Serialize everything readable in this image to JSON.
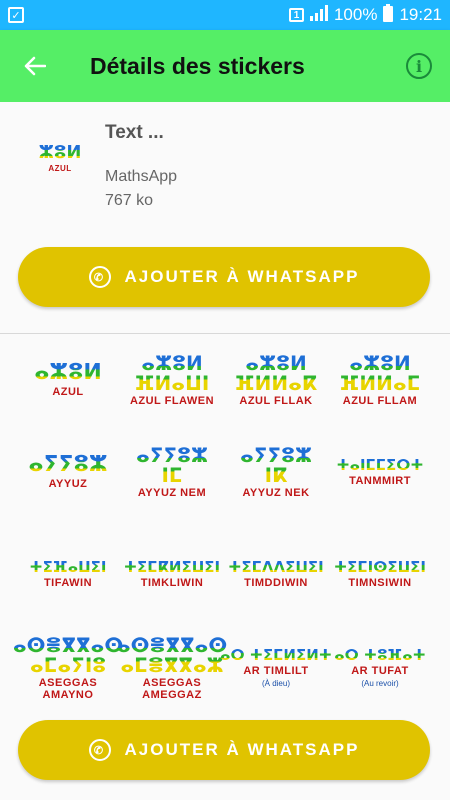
{
  "status_bar": {
    "sim": "1",
    "battery": "100%",
    "time": "19:21"
  },
  "app_bar": {
    "title": "Détails des stickers"
  },
  "pack": {
    "tray_glyphs": "ⵣⵓⵍ",
    "tray_label": "AZUL",
    "name": "Text ...",
    "publisher": "MathsApp",
    "size": "767 ko"
  },
  "buttons": {
    "add_label": "AJOUTER À WHATSAPP"
  },
  "stickers": [
    {
      "glyphs": "ⴰⵣⵓⵍ",
      "label": "AZUL",
      "sub": ""
    },
    {
      "glyphs": "ⴰⵣⵓⵍ\nⴼⵍⴰⵡⵏ",
      "label": "AZUL FLAWEN",
      "sub": ""
    },
    {
      "glyphs": "ⴰⵣⵓⵍ\nⴼⵍⵍⴰⴽ",
      "label": "AZUL FLLAK",
      "sub": ""
    },
    {
      "glyphs": "ⴰⵣⵓⵍ\nⴼⵍⵍⴰⵎ",
      "label": "AZUL FLLAM",
      "sub": ""
    },
    {
      "glyphs": "ⴰⵢⵢⵓⵣ",
      "label": "AYYUZ",
      "sub": ""
    },
    {
      "glyphs": "ⴰⵢⵢⵓⵣ\nⵏⵎ",
      "label": "AYYUZ NEM",
      "sub": ""
    },
    {
      "glyphs": "ⴰⵢⵢⵓⵣ\nⵏⴽ",
      "label": "AYYUZ NEK",
      "sub": ""
    },
    {
      "glyphs": "ⵜⴰⵏⵎⵎⵉⵔⵜ",
      "label": "TANMMIRT",
      "sub": ""
    },
    {
      "glyphs": "ⵜⵉⴼⴰⵡⵉⵏ",
      "label": "TIFAWIN",
      "sub": ""
    },
    {
      "glyphs": "ⵜⵉⵎⴽⵍⵉⵡⵉⵏ",
      "label": "TIMKLIWIN",
      "sub": ""
    },
    {
      "glyphs": "ⵜⵉⵎⴷⴷⵉⵡⵉⵏ",
      "label": "TIMDDIWIN",
      "sub": ""
    },
    {
      "glyphs": "ⵜⵉⵎⵏⵙⵉⵡⵉⵏ",
      "label": "TIMNSIWIN",
      "sub": ""
    },
    {
      "glyphs": "ⴰⵙⴻⴳⴳⴰⵙ\nⴰⵎⴰⵢⵏⵓ",
      "label": "ASEGGAS",
      "sub": "AMAYNO"
    },
    {
      "glyphs": "ⴰⵙⴻⴳⴳⴰⵙ\nⴰⵎⴻⴳⴳⴰⵣ",
      "label": "ASEGGAS",
      "sub": "AMEGGAZ"
    },
    {
      "glyphs": "ⴰⵔ ⵜⵉⵎⵍⵉⵍⵜ",
      "label": "AR TIMLILT",
      "sub": "(À dieu)"
    },
    {
      "glyphs": "ⴰⵔ ⵜⵓⴼⴰⵜ",
      "label": "AR TUFAT",
      "sub": "(Au revoir)"
    }
  ]
}
